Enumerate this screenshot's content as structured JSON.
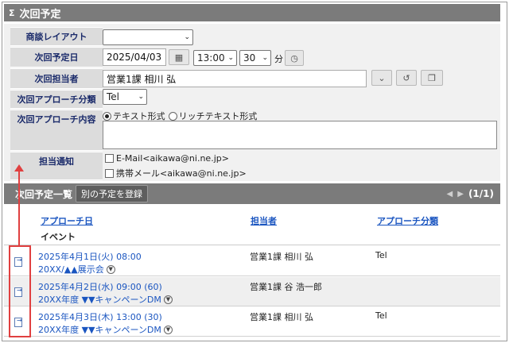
{
  "header": {
    "icon": "sigma-collapse-icon",
    "title": "次回予定"
  },
  "form": {
    "layout": {
      "label": "商談レイアウト",
      "value": ""
    },
    "date": {
      "label": "次回予定日",
      "value": "2025/04/03",
      "hour": "13:00",
      "minute": "30",
      "minute_unit": "分"
    },
    "owner": {
      "label": "次回担当者",
      "value": "営業1課 相川 弘"
    },
    "approach_type": {
      "label": "次回アプローチ分類",
      "value": "Tel"
    },
    "approach_content": {
      "label": "次回アプローチ内容",
      "opt_text": "テキスト形式",
      "opt_rich": "リッチテキスト形式",
      "selected": "テキスト形式"
    },
    "notify": {
      "label": "担当通知",
      "email": "E-Mail<aikawa@ni.ne.jp>",
      "mobile": "携帯メール<aikawa@ni.ne.jp>"
    }
  },
  "list": {
    "title": "次回予定一覧",
    "register_button": "別の予定を登録",
    "pager": "(1/1)",
    "columns": {
      "date": "アプローチ日",
      "owner": "担当者",
      "type": "アプローチ分類",
      "event": "イベント"
    },
    "rows": [
      {
        "date": "2025年4月1日(火) 08:00",
        "event": "20XX/▲▲展示会",
        "owner": "営業1課 相川 弘",
        "type": "Tel"
      },
      {
        "date": "2025年4月2日(水) 09:00 (60)",
        "event": "20XX年度 ▼▼キャンペーンDM",
        "owner": "営業1課 谷 浩一郎",
        "type": ""
      },
      {
        "date": "2025年4月3日(木) 13:00 (30)",
        "event": "20XX年度 ▼▼キャンペーンDM",
        "owner": "営業1課 相川 弘",
        "type": "Tel"
      }
    ]
  },
  "colors": {
    "header_bg": "#7b7b7b",
    "label_bg": "#dcdcdc",
    "link": "#1a55c0",
    "highlight": "#e04040"
  }
}
